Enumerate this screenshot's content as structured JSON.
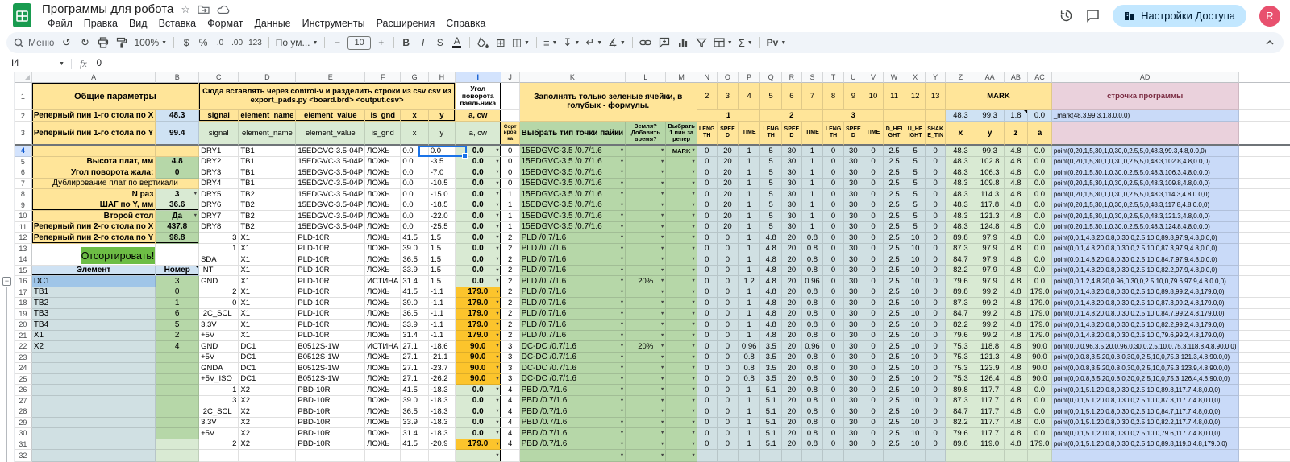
{
  "palette": {
    "yellow": "#ffe599",
    "green": "#b6d7a8",
    "green_light": "#d9ead3",
    "green_button": "#6dbd45",
    "amber": "#fcc42c",
    "blue_pale": "#cfe2f3",
    "cyan_pale": "#d0e0e3",
    "blue_mid": "#9fc5e8",
    "blue_row": "#c9daf8",
    "pink": "#ead1dc",
    "selection_blue": "#1a73e8",
    "header_highlight": "#d3e3fd",
    "share_pill": "#c2e7ff",
    "avatar": "#e8506e"
  },
  "app": {
    "title": "Программы для робота",
    "star": "☆",
    "menus": [
      "Файл",
      "Правка",
      "Вид",
      "Вставка",
      "Формат",
      "Данные",
      "Инструменты",
      "Расширения",
      "Справка"
    ],
    "share_label": "Настройки Доступа",
    "avatar_letter": "R"
  },
  "toolbar": {
    "search_label": "Меню",
    "undo": "↺",
    "redo": "↻",
    "zoom": "100%",
    "dollar": "$",
    "percent": "%",
    "dec0": ".0",
    "dec00": ".00",
    "fmt123": "123",
    "font": "По ум...",
    "minus": "−",
    "size": "10",
    "plus": "+",
    "bold": "B",
    "italic": "I",
    "strike": "S",
    "textcolor": "A",
    "borders": "⊞",
    "merge": "◫",
    "align": "≡",
    "valign": "↧",
    "wrap": "↵",
    "rotate": "∡",
    "sum": "Σ",
    "pv": "Pv"
  },
  "formula_bar": {
    "cell_ref": "I4",
    "fx_label": "fx",
    "value": "0"
  },
  "sheet": {
    "col_letters": [
      "A",
      "B",
      "C",
      "D",
      "E",
      "F",
      "G",
      "H",
      "I",
      "J",
      "K",
      "L",
      "M",
      "N",
      "O",
      "P",
      "Q",
      "R",
      "S",
      "T",
      "U",
      "V",
      "W",
      "X",
      "Y",
      "Z",
      "AA",
      "AB",
      "AC",
      "AD",
      ""
    ],
    "general_title": "Общие параметры",
    "params": [
      {
        "r": 2,
        "label": "Реперный пин 1-го стола по X",
        "value": "48.3",
        "style": "bp"
      },
      {
        "r": 3,
        "label": "Реперный пин 1-го стола по Y",
        "value": "99.4",
        "style": "bp"
      },
      {
        "r": 5,
        "label": "Высота плат, мм",
        "value": "4.8",
        "style": "gm"
      },
      {
        "r": 6,
        "label": "Угол поворота жала:",
        "value": "0",
        "style": "gm"
      },
      {
        "r": 8,
        "label": "N раз",
        "value": "3",
        "style": "gl",
        "dd": true
      },
      {
        "r": 9,
        "label": "ШАГ по Y, мм",
        "value": "36.6",
        "style": "gl"
      },
      {
        "r": 10,
        "label": "Второй стол",
        "value": "Да",
        "style": "gm",
        "dd": true
      },
      {
        "r": 11,
        "label": "Реперный пин 2-го стола по X",
        "value": "437.8",
        "style": "gm"
      },
      {
        "r": 12,
        "label": "Реперный пин 2-го стола по Y",
        "value": "98.8",
        "style": "gm"
      }
    ],
    "dup_label": "Дублирование плат по вертикали",
    "sort_button_label": "Отсортировать!",
    "element_header": [
      "Элемент",
      "Номер"
    ],
    "elements": [
      [
        "DC1",
        "3"
      ],
      [
        "TB1",
        "0"
      ],
      [
        "TB2",
        "1"
      ],
      [
        "TB3",
        "6"
      ],
      [
        "TB4",
        "5"
      ],
      [
        "X1",
        "2"
      ],
      [
        "X2",
        "4"
      ]
    ],
    "paste_header": "Сюда вставлять через control-v и разделить строки из csv csv из export_pads.py <board.brd> <output.csv>",
    "csv_cols": [
      "signal",
      "element_name",
      "element_value",
      "is_gnd",
      "x",
      "y"
    ],
    "angle_header": "Угол поворота паяльника",
    "angle_sub": "a, cw",
    "sort_col_header": "Сортировка",
    "note_header": "Заполнять только зеленые ячейки, в голубых - формулы.",
    "k_header": "Выбрать тип точки пайки",
    "l_header": "Земля? Добавить время?",
    "m_header": "Выбрать 1 пин за репер",
    "point_numbers": [
      "2",
      "3",
      "4",
      "5",
      "6",
      "7",
      "8",
      "9",
      "10",
      "11",
      "12",
      "13"
    ],
    "point_groups": [
      "1",
      "2",
      "3"
    ],
    "param_headers": [
      "LENGTH",
      "SPEED",
      "TIME",
      "LENGTH",
      "SPEED",
      "TIME",
      "LENGTH",
      "SPEED",
      "TIME",
      "D_HEIGHT",
      "U_HEIGHT",
      "SHAKE_TIN"
    ],
    "mark_label": "MARK",
    "mark_values": [
      "48.3",
      "99.3",
      "1.8",
      "0.0"
    ],
    "mark_formula": "_mark(48.3,99.3,1.8,0.0,0)",
    "coord_headers": [
      "x",
      "y",
      "z",
      "a"
    ],
    "program_header": "строчка программы",
    "rows": [
      [
        "DRY1",
        "TB1",
        "15EDGVC-3.5-04P",
        "ЛОЖЬ",
        "0.0",
        "0.0",
        "0.0",
        "0",
        "15EDGVC-3.5 /0.7/1.6",
        "",
        "MARK",
        [
          "0",
          "20",
          "1",
          "5",
          "30",
          "1",
          "0",
          "30",
          "0",
          "2.5",
          "5",
          "0"
        ],
        "48.3",
        "99.3",
        "4.8",
        "0.0",
        "point(0,20,1,5,30,1,0,30,0,2.5,5,0,48.3,99.3,4.8,0.0,0)"
      ],
      [
        "DRY2",
        "TB1",
        "15EDGVC-3.5-04P",
        "ЛОЖЬ",
        "0.0",
        "-3.5",
        "0.0",
        "0",
        "15EDGVC-3.5 /0.7/1.6",
        "",
        "",
        [
          "0",
          "20",
          "1",
          "5",
          "30",
          "1",
          "0",
          "30",
          "0",
          "2.5",
          "5",
          "0"
        ],
        "48.3",
        "102.8",
        "4.8",
        "0.0",
        "point(0,20,1,5,30,1,0,30,0,2.5,5,0,48.3,102.8,4.8,0.0,0)"
      ],
      [
        "DRY3",
        "TB1",
        "15EDGVC-3.5-04P",
        "ЛОЖЬ",
        "0.0",
        "-7.0",
        "0.0",
        "0",
        "15EDGVC-3.5 /0.7/1.6",
        "",
        "",
        [
          "0",
          "20",
          "1",
          "5",
          "30",
          "1",
          "0",
          "30",
          "0",
          "2.5",
          "5",
          "0"
        ],
        "48.3",
        "106.3",
        "4.8",
        "0.0",
        "point(0,20,1,5,30,1,0,30,0,2.5,5,0,48.3,106.3,4.8,0.0,0)"
      ],
      [
        "DRY4",
        "TB1",
        "15EDGVC-3.5-04P",
        "ЛОЖЬ",
        "0.0",
        "-10.5",
        "0.0",
        "0",
        "15EDGVC-3.5 /0.7/1.6",
        "",
        "",
        [
          "0",
          "20",
          "1",
          "5",
          "30",
          "1",
          "0",
          "30",
          "0",
          "2.5",
          "5",
          "0"
        ],
        "48.3",
        "109.8",
        "4.8",
        "0.0",
        "point(0,20,1,5,30,1,0,30,0,2.5,5,0,48.3,109.8,4.8,0.0,0)"
      ],
      [
        "DRY5",
        "TB2",
        "15EDGVC-3.5-04P",
        "ЛОЖЬ",
        "0.0",
        "-15.0",
        "0.0",
        "1",
        "15EDGVC-3.5 /0.7/1.6",
        "",
        "",
        [
          "0",
          "20",
          "1",
          "5",
          "30",
          "1",
          "0",
          "30",
          "0",
          "2.5",
          "5",
          "0"
        ],
        "48.3",
        "114.3",
        "4.8",
        "0.0",
        "point(0,20,1,5,30,1,0,30,0,2.5,5,0,48.3,114.3,4.8,0.0,0)"
      ],
      [
        "DRY6",
        "TB2",
        "15EDGVC-3.5-04P",
        "ЛОЖЬ",
        "0.0",
        "-18.5",
        "0.0",
        "1",
        "15EDGVC-3.5 /0.7/1.6",
        "",
        "",
        [
          "0",
          "20",
          "1",
          "5",
          "30",
          "1",
          "0",
          "30",
          "0",
          "2.5",
          "5",
          "0"
        ],
        "48.3",
        "117.8",
        "4.8",
        "0.0",
        "point(0,20,1,5,30,1,0,30,0,2.5,5,0,48.3,117.8,4.8,0.0,0)"
      ],
      [
        "DRY7",
        "TB2",
        "15EDGVC-3.5-04P",
        "ЛОЖЬ",
        "0.0",
        "-22.0",
        "0.0",
        "1",
        "15EDGVC-3.5 /0.7/1.6",
        "",
        "",
        [
          "0",
          "20",
          "1",
          "5",
          "30",
          "1",
          "0",
          "30",
          "0",
          "2.5",
          "5",
          "0"
        ],
        "48.3",
        "121.3",
        "4.8",
        "0.0",
        "point(0,20,1,5,30,1,0,30,0,2.5,5,0,48.3,121.3,4.8,0.0,0)"
      ],
      [
        "DRY8",
        "TB2",
        "15EDGVC-3.5-04P",
        "ЛОЖЬ",
        "0.0",
        "-25.5",
        "0.0",
        "1",
        "15EDGVC-3.5 /0.7/1.6",
        "",
        "",
        [
          "0",
          "20",
          "1",
          "5",
          "30",
          "1",
          "0",
          "30",
          "0",
          "2.5",
          "5",
          "0"
        ],
        "48.3",
        "124.8",
        "4.8",
        "0.0",
        "point(0,20,1,5,30,1,0,30,0,2.5,5,0,48.3,124.8,4.8,0.0,0)"
      ],
      [
        "3",
        "X1",
        "PLD-10R",
        "ЛОЖЬ",
        "41.5",
        "1.5",
        "0.0",
        "2",
        "PLD /0.7/1.6",
        "",
        "",
        [
          "0",
          "0",
          "1",
          "4.8",
          "20",
          "0.8",
          "0",
          "30",
          "0",
          "2.5",
          "10",
          "0"
        ],
        "89.8",
        "97.9",
        "4.8",
        "0.0",
        "point(0,0,1,4.8,20,0.8,0,30,0,2.5,10,0,89.8,97.9,4.8,0.0,0)"
      ],
      [
        "1",
        "X1",
        "PLD-10R",
        "ЛОЖЬ",
        "39.0",
        "1.5",
        "0.0",
        "2",
        "PLD /0.7/1.6",
        "",
        "",
        [
          "0",
          "0",
          "1",
          "4.8",
          "20",
          "0.8",
          "0",
          "30",
          "0",
          "2.5",
          "10",
          "0"
        ],
        "87.3",
        "97.9",
        "4.8",
        "0.0",
        "point(0,0,1,4.8,20,0.8,0,30,0,2.5,10,0,87.3,97.9,4.8,0.0,0)"
      ],
      [
        "SDA",
        "X1",
        "PLD-10R",
        "ЛОЖЬ",
        "36.5",
        "1.5",
        "0.0",
        "2",
        "PLD /0.7/1.6",
        "",
        "",
        [
          "0",
          "0",
          "1",
          "4.8",
          "20",
          "0.8",
          "0",
          "30",
          "0",
          "2.5",
          "10",
          "0"
        ],
        "84.7",
        "97.9",
        "4.8",
        "0.0",
        "point(0,0,1,4.8,20,0.8,0,30,0,2.5,10,0,84.7,97.9,4.8,0.0,0)"
      ],
      [
        "INT",
        "X1",
        "PLD-10R",
        "ЛОЖЬ",
        "33.9",
        "1.5",
        "0.0",
        "2",
        "PLD /0.7/1.6",
        "",
        "",
        [
          "0",
          "0",
          "1",
          "4.8",
          "20",
          "0.8",
          "0",
          "30",
          "0",
          "2.5",
          "10",
          "0"
        ],
        "82.2",
        "97.9",
        "4.8",
        "0.0",
        "point(0,0,1,4.8,20,0.8,0,30,0,2.5,10,0,82.2,97.9,4.8,0.0,0)"
      ],
      [
        "GND",
        "X1",
        "PLD-10R",
        "ИСТИНА",
        "31.4",
        "1.5",
        "0.0",
        "2",
        "PLD /0.7/1.6",
        "20%",
        "",
        [
          "0",
          "0",
          "1.2",
          "4.8",
          "20",
          "0.96",
          "0",
          "30",
          "0",
          "2.5",
          "10",
          "0"
        ],
        "79.6",
        "97.9",
        "4.8",
        "0.0",
        "point(0,0,1.2,4.8,20,0.96,0,30,0,2.5,10,0,79.6,97.9,4.8,0.0,0)"
      ],
      [
        "2",
        "X1",
        "PLD-10R",
        "ЛОЖЬ",
        "41.5",
        "-1.1",
        "179.0",
        "2",
        "PLD /0.7/1.6",
        "",
        "",
        [
          "0",
          "0",
          "1",
          "4.8",
          "20",
          "0.8",
          "0",
          "30",
          "0",
          "2.5",
          "10",
          "0"
        ],
        "89.8",
        "99.2",
        "4.8",
        "179.0",
        "point(0,0,1,4.8,20,0.8,0,30,0,2.5,10,0,89.8,99.2,4.8,179.0,0)"
      ],
      [
        "0",
        "X1",
        "PLD-10R",
        "ЛОЖЬ",
        "39.0",
        "-1.1",
        "179.0",
        "2",
        "PLD /0.7/1.6",
        "",
        "",
        [
          "0",
          "0",
          "1",
          "4.8",
          "20",
          "0.8",
          "0",
          "30",
          "0",
          "2.5",
          "10",
          "0"
        ],
        "87.3",
        "99.2",
        "4.8",
        "179.0",
        "point(0,0,1,4.8,20,0.8,0,30,0,2.5,10,0,87.3,99.2,4.8,179.0,0)"
      ],
      [
        "I2C_SCL",
        "X1",
        "PLD-10R",
        "ЛОЖЬ",
        "36.5",
        "-1.1",
        "179.0",
        "2",
        "PLD /0.7/1.6",
        "",
        "",
        [
          "0",
          "0",
          "1",
          "4.8",
          "20",
          "0.8",
          "0",
          "30",
          "0",
          "2.5",
          "10",
          "0"
        ],
        "84.7",
        "99.2",
        "4.8",
        "179.0",
        "point(0,0,1,4.8,20,0.8,0,30,0,2.5,10,0,84.7,99.2,4.8,179.0,0)"
      ],
      [
        "3.3V",
        "X1",
        "PLD-10R",
        "ЛОЖЬ",
        "33.9",
        "-1.1",
        "179.0",
        "2",
        "PLD /0.7/1.6",
        "",
        "",
        [
          "0",
          "0",
          "1",
          "4.8",
          "20",
          "0.8",
          "0",
          "30",
          "0",
          "2.5",
          "10",
          "0"
        ],
        "82.2",
        "99.2",
        "4.8",
        "179.0",
        "point(0,0,1,4.8,20,0.8,0,30,0,2.5,10,0,82.2,99.2,4.8,179.0,0)"
      ],
      [
        "+5V",
        "X1",
        "PLD-10R",
        "ЛОЖЬ",
        "31.4",
        "-1.1",
        "179.0",
        "2",
        "PLD /0.7/1.6",
        "",
        "",
        [
          "0",
          "0",
          "1",
          "4.8",
          "20",
          "0.8",
          "0",
          "30",
          "0",
          "2.5",
          "10",
          "0"
        ],
        "79.6",
        "99.2",
        "4.8",
        "179.0",
        "point(0,0,1,4.8,20,0.8,0,30,0,2.5,10,0,79.6,99.2,4.8,179.0,0)"
      ],
      [
        "GND",
        "DC1",
        "B0512S-1W",
        "ИСТИНА",
        "27.1",
        "-18.6",
        "90.0",
        "3",
        "DC-DC /0.7/1.6",
        "20%",
        "",
        [
          "0",
          "0",
          "0.96",
          "3.5",
          "20",
          "0.96",
          "0",
          "30",
          "0",
          "2.5",
          "10",
          "0"
        ],
        "75.3",
        "118.8",
        "4.8",
        "90.0",
        "point(0,0,0.96,3.5,20,0.96,0,30,0,2.5,10,0,75.3,118.8,4.8,90.0,0)"
      ],
      [
        "+5V",
        "DC1",
        "B0512S-1W",
        "ЛОЖЬ",
        "27.1",
        "-21.1",
        "90.0",
        "3",
        "DC-DC /0.7/1.6",
        "",
        "",
        [
          "0",
          "0",
          "0.8",
          "3.5",
          "20",
          "0.8",
          "0",
          "30",
          "0",
          "2.5",
          "10",
          "0"
        ],
        "75.3",
        "121.3",
        "4.8",
        "90.0",
        "point(0,0,0.8,3.5,20,0.8,0,30,0,2.5,10,0,75.3,121.3,4.8,90.0,0)"
      ],
      [
        "GNDA",
        "DC1",
        "B0512S-1W",
        "ЛОЖЬ",
        "27.1",
        "-23.7",
        "90.0",
        "3",
        "DC-DC /0.7/1.6",
        "",
        "",
        [
          "0",
          "0",
          "0.8",
          "3.5",
          "20",
          "0.8",
          "0",
          "30",
          "0",
          "2.5",
          "10",
          "0"
        ],
        "75.3",
        "123.9",
        "4.8",
        "90.0",
        "point(0,0,0.8,3.5,20,0.8,0,30,0,2.5,10,0,75.3,123.9,4.8,90.0,0)"
      ],
      [
        "+5V_ISO",
        "DC1",
        "B0512S-1W",
        "ЛОЖЬ",
        "27.1",
        "-26.2",
        "90.0",
        "3",
        "DC-DC /0.7/1.6",
        "",
        "",
        [
          "0",
          "0",
          "0.8",
          "3.5",
          "20",
          "0.8",
          "0",
          "30",
          "0",
          "2.5",
          "10",
          "0"
        ],
        "75.3",
        "126.4",
        "4.8",
        "90.0",
        "point(0,0,0.8,3.5,20,0.8,0,30,0,2.5,10,0,75.3,126.4,4.8,90.0,0)"
      ],
      [
        "1",
        "X2",
        "PBD-10R",
        "ЛОЖЬ",
        "41.5",
        "-18.3",
        "0.0",
        "4",
        "PBD /0.7/1.6",
        "",
        "",
        [
          "0",
          "0",
          "1",
          "5.1",
          "20",
          "0.8",
          "0",
          "30",
          "0",
          "2.5",
          "10",
          "0"
        ],
        "89.8",
        "117.7",
        "4.8",
        "0.0",
        "point(0,0,1,5.1,20,0.8,0,30,0,2.5,10,0,89.8,117.7,4.8,0.0,0)"
      ],
      [
        "3",
        "X2",
        "PBD-10R",
        "ЛОЖЬ",
        "39.0",
        "-18.3",
        "0.0",
        "4",
        "PBD /0.7/1.6",
        "",
        "",
        [
          "0",
          "0",
          "1",
          "5.1",
          "20",
          "0.8",
          "0",
          "30",
          "0",
          "2.5",
          "10",
          "0"
        ],
        "87.3",
        "117.7",
        "4.8",
        "0.0",
        "point(0,0,1,5.1,20,0.8,0,30,0,2.5,10,0,87.3,117.7,4.8,0.0,0)"
      ],
      [
        "I2C_SCL",
        "X2",
        "PBD-10R",
        "ЛОЖЬ",
        "36.5",
        "-18.3",
        "0.0",
        "4",
        "PBD /0.7/1.6",
        "",
        "",
        [
          "0",
          "0",
          "1",
          "5.1",
          "20",
          "0.8",
          "0",
          "30",
          "0",
          "2.5",
          "10",
          "0"
        ],
        "84.7",
        "117.7",
        "4.8",
        "0.0",
        "point(0,0,1,5.1,20,0.8,0,30,0,2.5,10,0,84.7,117.7,4.8,0.0,0)"
      ],
      [
        "3.3V",
        "X2",
        "PBD-10R",
        "ЛОЖЬ",
        "33.9",
        "-18.3",
        "0.0",
        "4",
        "PBD /0.7/1.6",
        "",
        "",
        [
          "0",
          "0",
          "1",
          "5.1",
          "20",
          "0.8",
          "0",
          "30",
          "0",
          "2.5",
          "10",
          "0"
        ],
        "82.2",
        "117.7",
        "4.8",
        "0.0",
        "point(0,0,1,5.1,20,0.8,0,30,0,2.5,10,0,82.2,117.7,4.8,0.0,0)"
      ],
      [
        "+5V",
        "X2",
        "PBD-10R",
        "ЛОЖЬ",
        "31.4",
        "-18.3",
        "0.0",
        "4",
        "PBD /0.7/1.6",
        "",
        "",
        [
          "0",
          "0",
          "1",
          "5.1",
          "20",
          "0.8",
          "0",
          "30",
          "0",
          "2.5",
          "10",
          "0"
        ],
        "79.6",
        "117.7",
        "4.8",
        "0.0",
        "point(0,0,1,5.1,20,0.8,0,30,0,2.5,10,0,79.6,117.7,4.8,0.0,0)"
      ],
      [
        "2",
        "X2",
        "PBD-10R",
        "ЛОЖЬ",
        "41.5",
        "-20.9",
        "179.0",
        "4",
        "PBD /0.7/1.6",
        "",
        "",
        [
          "0",
          "0",
          "1",
          "5.1",
          "20",
          "0.8",
          "0",
          "30",
          "0",
          "2.5",
          "10",
          "0"
        ],
        "89.8",
        "119.0",
        "4.8",
        "179.0",
        "point(0,0,1,5.1,20,0.8,0,30,0,2.5,10,0,89.8,119.0,4.8,179.0,0)"
      ]
    ]
  }
}
